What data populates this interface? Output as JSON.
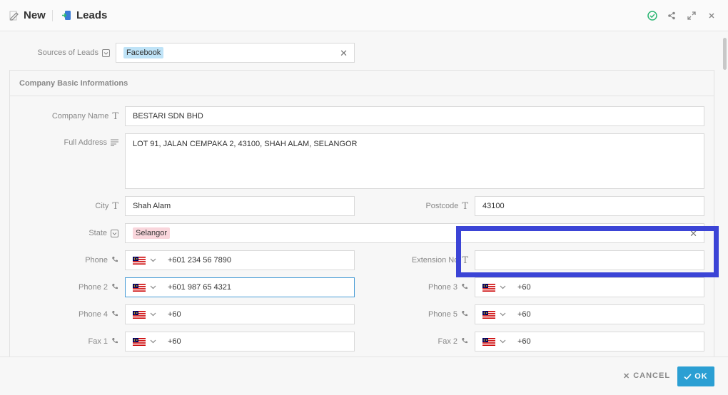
{
  "header": {
    "new_label": "New",
    "module_label": "Leads"
  },
  "sources": {
    "label": "Sources of Leads",
    "tag": "Facebook"
  },
  "card": {
    "title": "Company Basic Informations"
  },
  "fields": {
    "company_name": {
      "label": "Company Name",
      "value": "BESTARI SDN BHD"
    },
    "full_address": {
      "label": "Full Address",
      "value": "LOT 91, JALAN CEMPAKA 2, 43100, SHAH ALAM, SELANGOR"
    },
    "city": {
      "label": "City",
      "value": "Shah Alam"
    },
    "postcode": {
      "label": "Postcode",
      "value": "43100"
    },
    "state": {
      "label": "State",
      "tag": "Selangor"
    },
    "phone": {
      "label": "Phone",
      "value": "+601 234 56 7890"
    },
    "extension": {
      "label": "Extension No",
      "value": ""
    },
    "phone2": {
      "label": "Phone 2",
      "value": "+601 987 65 4321"
    },
    "phone3": {
      "label": "Phone 3",
      "value": "+60"
    },
    "phone4": {
      "label": "Phone 4",
      "value": "+60"
    },
    "phone5": {
      "label": "Phone 5",
      "value": "+60"
    },
    "fax1": {
      "label": "Fax 1",
      "value": "+60"
    },
    "fax2": {
      "label": "Fax 2",
      "value": "+60"
    }
  },
  "footer": {
    "cancel": "CANCEL",
    "ok": "OK"
  },
  "colors": {
    "accent": "#2b9fd3",
    "facebook_tag": "#bfe3f7",
    "state_tag": "#f9d6dc",
    "highlight": "#3b44d6",
    "check": "#2bb673"
  }
}
